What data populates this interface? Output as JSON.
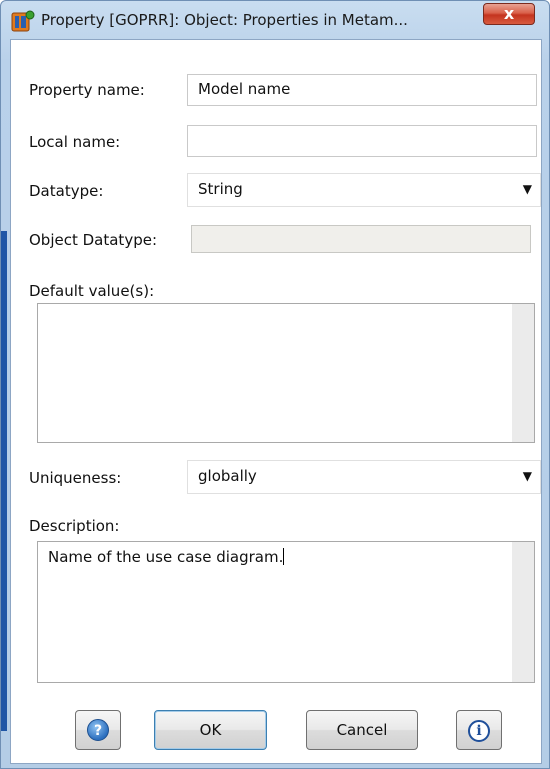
{
  "window": {
    "title": "Property [GOPRR]: Object: Properties in Metam...",
    "close_glyph": "x"
  },
  "form": {
    "property_name": {
      "label": "Property name:",
      "value": "Model name"
    },
    "local_name": {
      "label": "Local name:",
      "value": ""
    },
    "datatype": {
      "label": "Datatype:",
      "value": "String"
    },
    "object_datatype": {
      "label": "Object Datatype:",
      "value": ""
    },
    "default_values": {
      "label": "Default value(s):",
      "value": ""
    },
    "uniqueness": {
      "label": "Uniqueness:",
      "value": "globally"
    },
    "description": {
      "label": "Description:",
      "value": "Name of the use case diagram."
    }
  },
  "buttons": {
    "help_glyph": "?",
    "ok": "OK",
    "cancel": "Cancel",
    "info_glyph": "i"
  },
  "icons": {
    "app": "metaedit-app-icon",
    "dropdown": "chevron-down-icon",
    "help": "help-icon",
    "info": "info-icon"
  },
  "colors": {
    "accent": "#1f56a6",
    "close": "#c4341f"
  }
}
